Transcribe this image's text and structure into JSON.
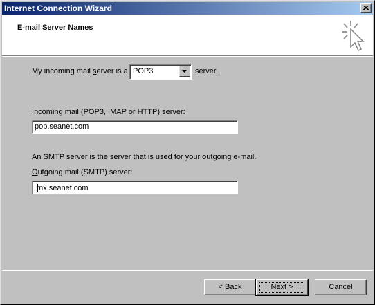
{
  "window": {
    "title": "Internet Connection Wizard"
  },
  "header": {
    "title": "E-mail Server Names"
  },
  "incoming_server": {
    "label_pre": "My incoming mail ",
    "label_key": "s",
    "label_post": "erver is a",
    "type_value": "POP3",
    "label_suffix": "server."
  },
  "incoming_field": {
    "label_key": "I",
    "label_rest": "ncoming mail (POP3, IMAP or HTTP) server:",
    "value": "pop.seanet.com"
  },
  "smtp_info": "An SMTP server is the server that is used for your outgoing e-mail.",
  "outgoing_field": {
    "label_key": "O",
    "label_rest": "utgoing mail (SMTP) server:",
    "value": "mx.seanet.com"
  },
  "buttons": {
    "back_symbol": "< ",
    "back_key": "B",
    "back_rest": "ack",
    "next_key": "N",
    "next_rest": "ext >",
    "cancel": "Cancel"
  },
  "icons": [
    "close-icon",
    "wizard-cursor-icon",
    "dropdown-arrow-icon"
  ]
}
